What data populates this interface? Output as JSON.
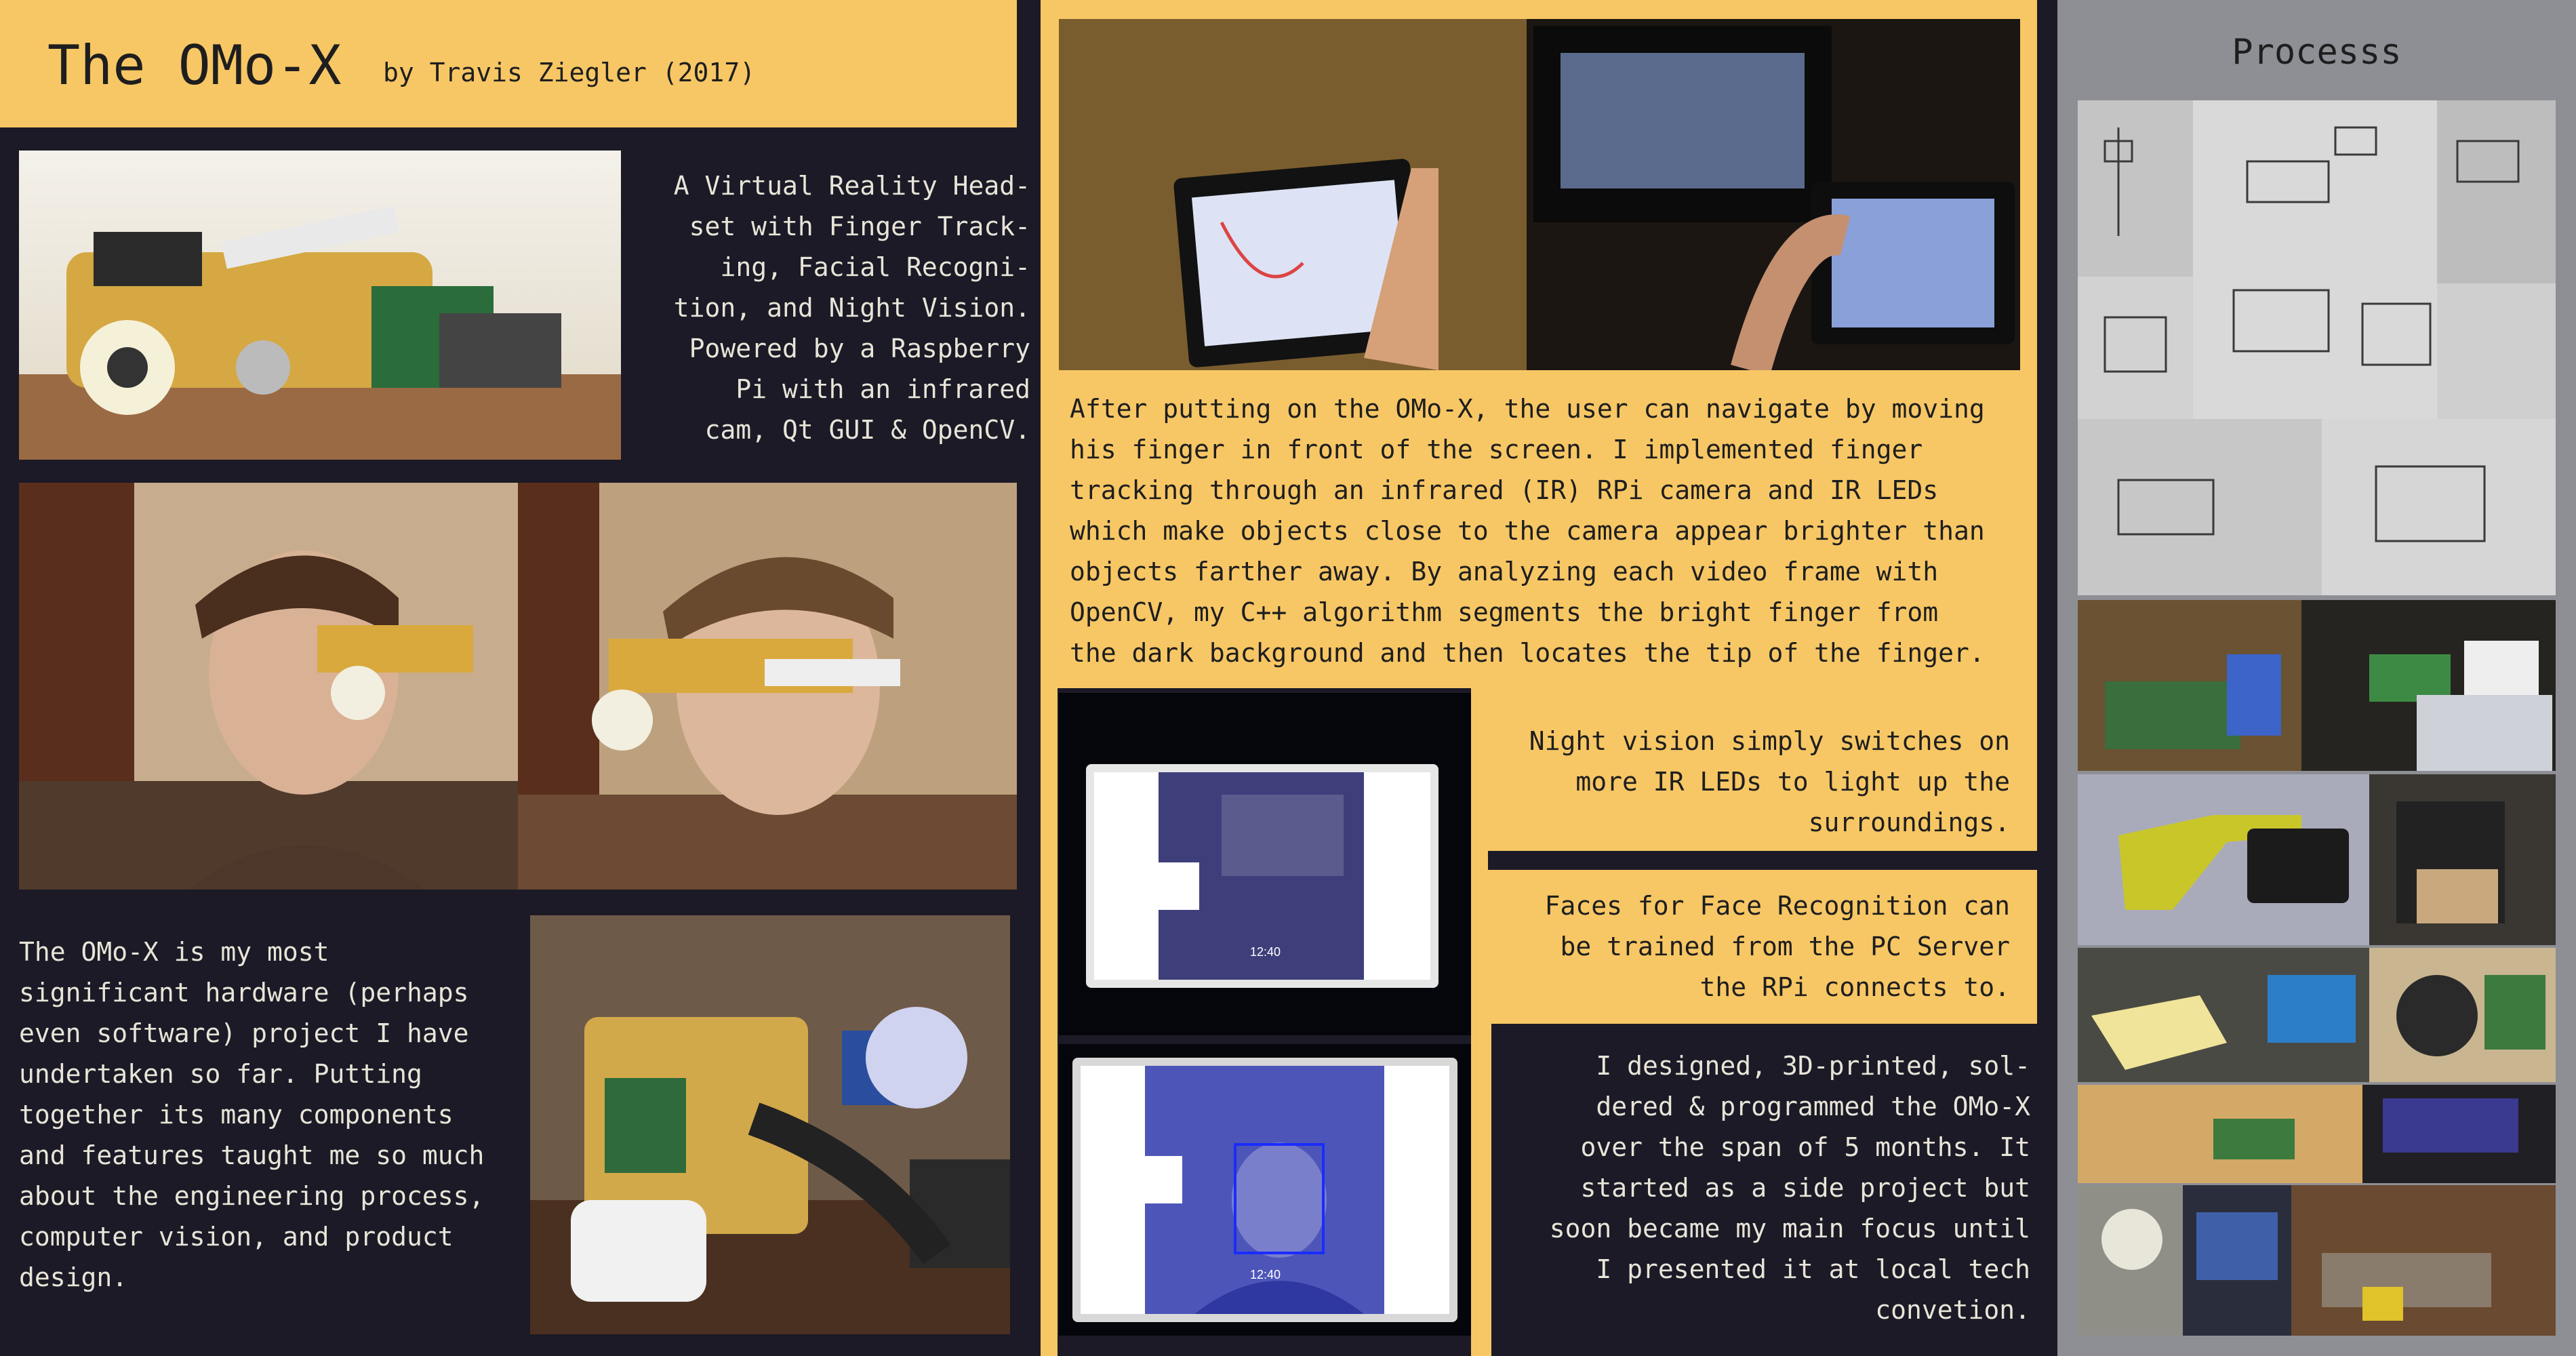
{
  "title": {
    "main": "The OMo-X",
    "byline": "by Travis Ziegler (2017)"
  },
  "intro": {
    "lines": [
      "A Virtual Reality Head-",
      "set with Finger Track-",
      "ing, Facial Recogni-",
      "tion, and Night Vision.",
      "Powered by a Raspberry",
      "Pi with an infrared",
      "cam, Qt GUI & OpenCV."
    ]
  },
  "finger_tracking": {
    "lines": [
      "After putting on the OMo-X, the user can navigate by moving",
      "his finger in front of the screen. I implemented finger",
      "tracking through an infrared (IR) RPi camera and IR LEDs",
      "which make objects close to the camera appear brighter than",
      "objects farther away. By analyzing each video frame with",
      "OpenCV, my C++ algorithm segments the bright finger from",
      "the dark background and then locates the tip of the finger."
    ]
  },
  "night_vision": {
    "lines": [
      "Night vision simply switches on",
      "more IR LEDs to light up the",
      "surroundings."
    ]
  },
  "faces": {
    "lines": [
      "Faces for Face Recognition can",
      "be trained from the PC Server",
      "the RPi connects to."
    ]
  },
  "design": {
    "lines": [
      "I designed, 3D-printed, sol-",
      "dered & programmed the OMo-X",
      "over the span of 5 months. It",
      "started as a side project but",
      "soon became my main focus until",
      "I presented it at local tech",
      "convetion."
    ]
  },
  "significance": {
    "lines": [
      "The OMo-X is my most",
      "significant hardware (perhaps",
      "even software) project I have",
      "undertaken so far. Putting",
      "together its many components",
      "and features taught me so much",
      "about the engineering process,",
      "computer vision, and product",
      "design."
    ]
  },
  "process": {
    "title": "Processs"
  },
  "screens": {
    "time_1": "12:40",
    "time_2": "12:40"
  },
  "colors": {
    "accent_yellow": "#f7c765",
    "dark_background": "#1b1a26",
    "process_gray": "#8e8f95"
  }
}
